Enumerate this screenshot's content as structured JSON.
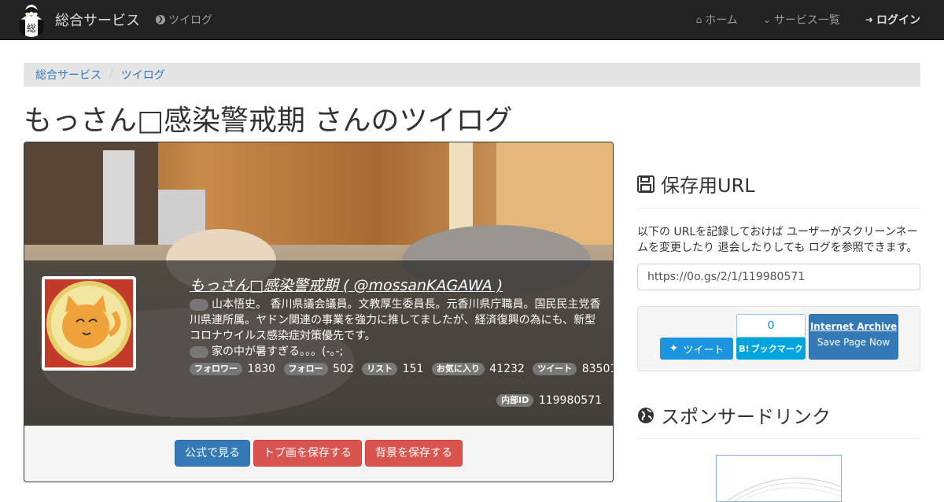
{
  "navbar": {
    "brand_label": "総合サービス",
    "twilog_label": "ツイログ",
    "home_label": "ホーム",
    "services_label": "サービス一覧",
    "login_label": "ログイン"
  },
  "breadcrumb": [
    "総合サービス",
    "ツイログ"
  ],
  "page_title": "もっさん□感染警戒期 さんのツイログ",
  "profile": {
    "name": "もっさん□感染警戒期 ( @mossanKAGAWA )",
    "bio": "山本悟史。 香川県議会議員。文教厚生委員長。元香川県庁職員。国民民主党香川県連所属。ヤドン関連の事業を強力に推してましたが、経済復興の為にも、新型コロナウイルス感染症対策優先です。",
    "latest_tweet": "家の中が暑すぎる。。。(-｡-;",
    "stats": [
      {
        "label": "フォロワー",
        "value": "1830"
      },
      {
        "label": "フォロー",
        "value": "502"
      },
      {
        "label": "リスト",
        "value": "151"
      },
      {
        "label": "お気に入り",
        "value": "41232"
      },
      {
        "label": "ツイート",
        "value": "83501"
      }
    ],
    "internal_id_label": "内部ID",
    "internal_id": "119980571"
  },
  "actions": {
    "official": "公式で見る",
    "save_icon": "トプ画を保存する",
    "save_bg": "背景を保存する"
  },
  "sidebar": {
    "save_url_heading": "保存用URL",
    "save_url_desc": "以下の URLを記録しておけば ユーザーがスクリーンネームを変更したり 退会したりしても ログを参照できます。",
    "save_url_value": "https://0o.gs/2/1/119980571",
    "tweet_label": "ツイート",
    "hatena_count": "0",
    "hatena_label": "ブックマーク",
    "ia_title": "Internet Archive",
    "ia_sub": "Save Page Now",
    "sponsor_heading": "スポンサードリンク"
  },
  "colors": {
    "navbar_bg": "#222222",
    "link": "#337ab7",
    "primary": "#337ab7",
    "danger": "#d9534f",
    "twitter": "#1b95e0",
    "hatena": "#00a4de"
  }
}
